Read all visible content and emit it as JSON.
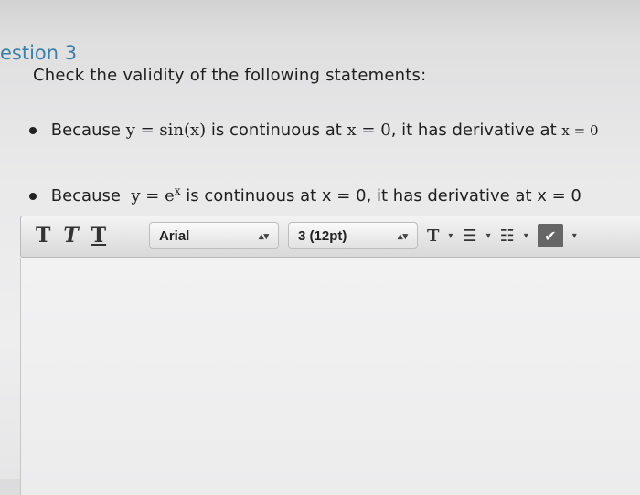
{
  "question": {
    "title": "estion 3",
    "prompt": "Check the validity of the following statements:"
  },
  "statements": [
    {
      "lead": "Because",
      "math": "y = sin(x)",
      "middle": "is continuous at",
      "cond": "x = 0",
      "tail": ", it has derivative at",
      "end": "x = 0"
    },
    {
      "lead": "Because",
      "math_base": "y = e",
      "math_exp": "x",
      "middle": "is continuous at",
      "cond": "x = 0",
      "tail": ", it has derivative at",
      "end": "x = 0"
    }
  ],
  "toolbar": {
    "style_buttons": [
      "T",
      "T",
      "T"
    ],
    "font": "Arial",
    "size": "3 (12pt)",
    "text_color": "T",
    "select_arrows": "▴▾",
    "dropdown": "▾"
  }
}
